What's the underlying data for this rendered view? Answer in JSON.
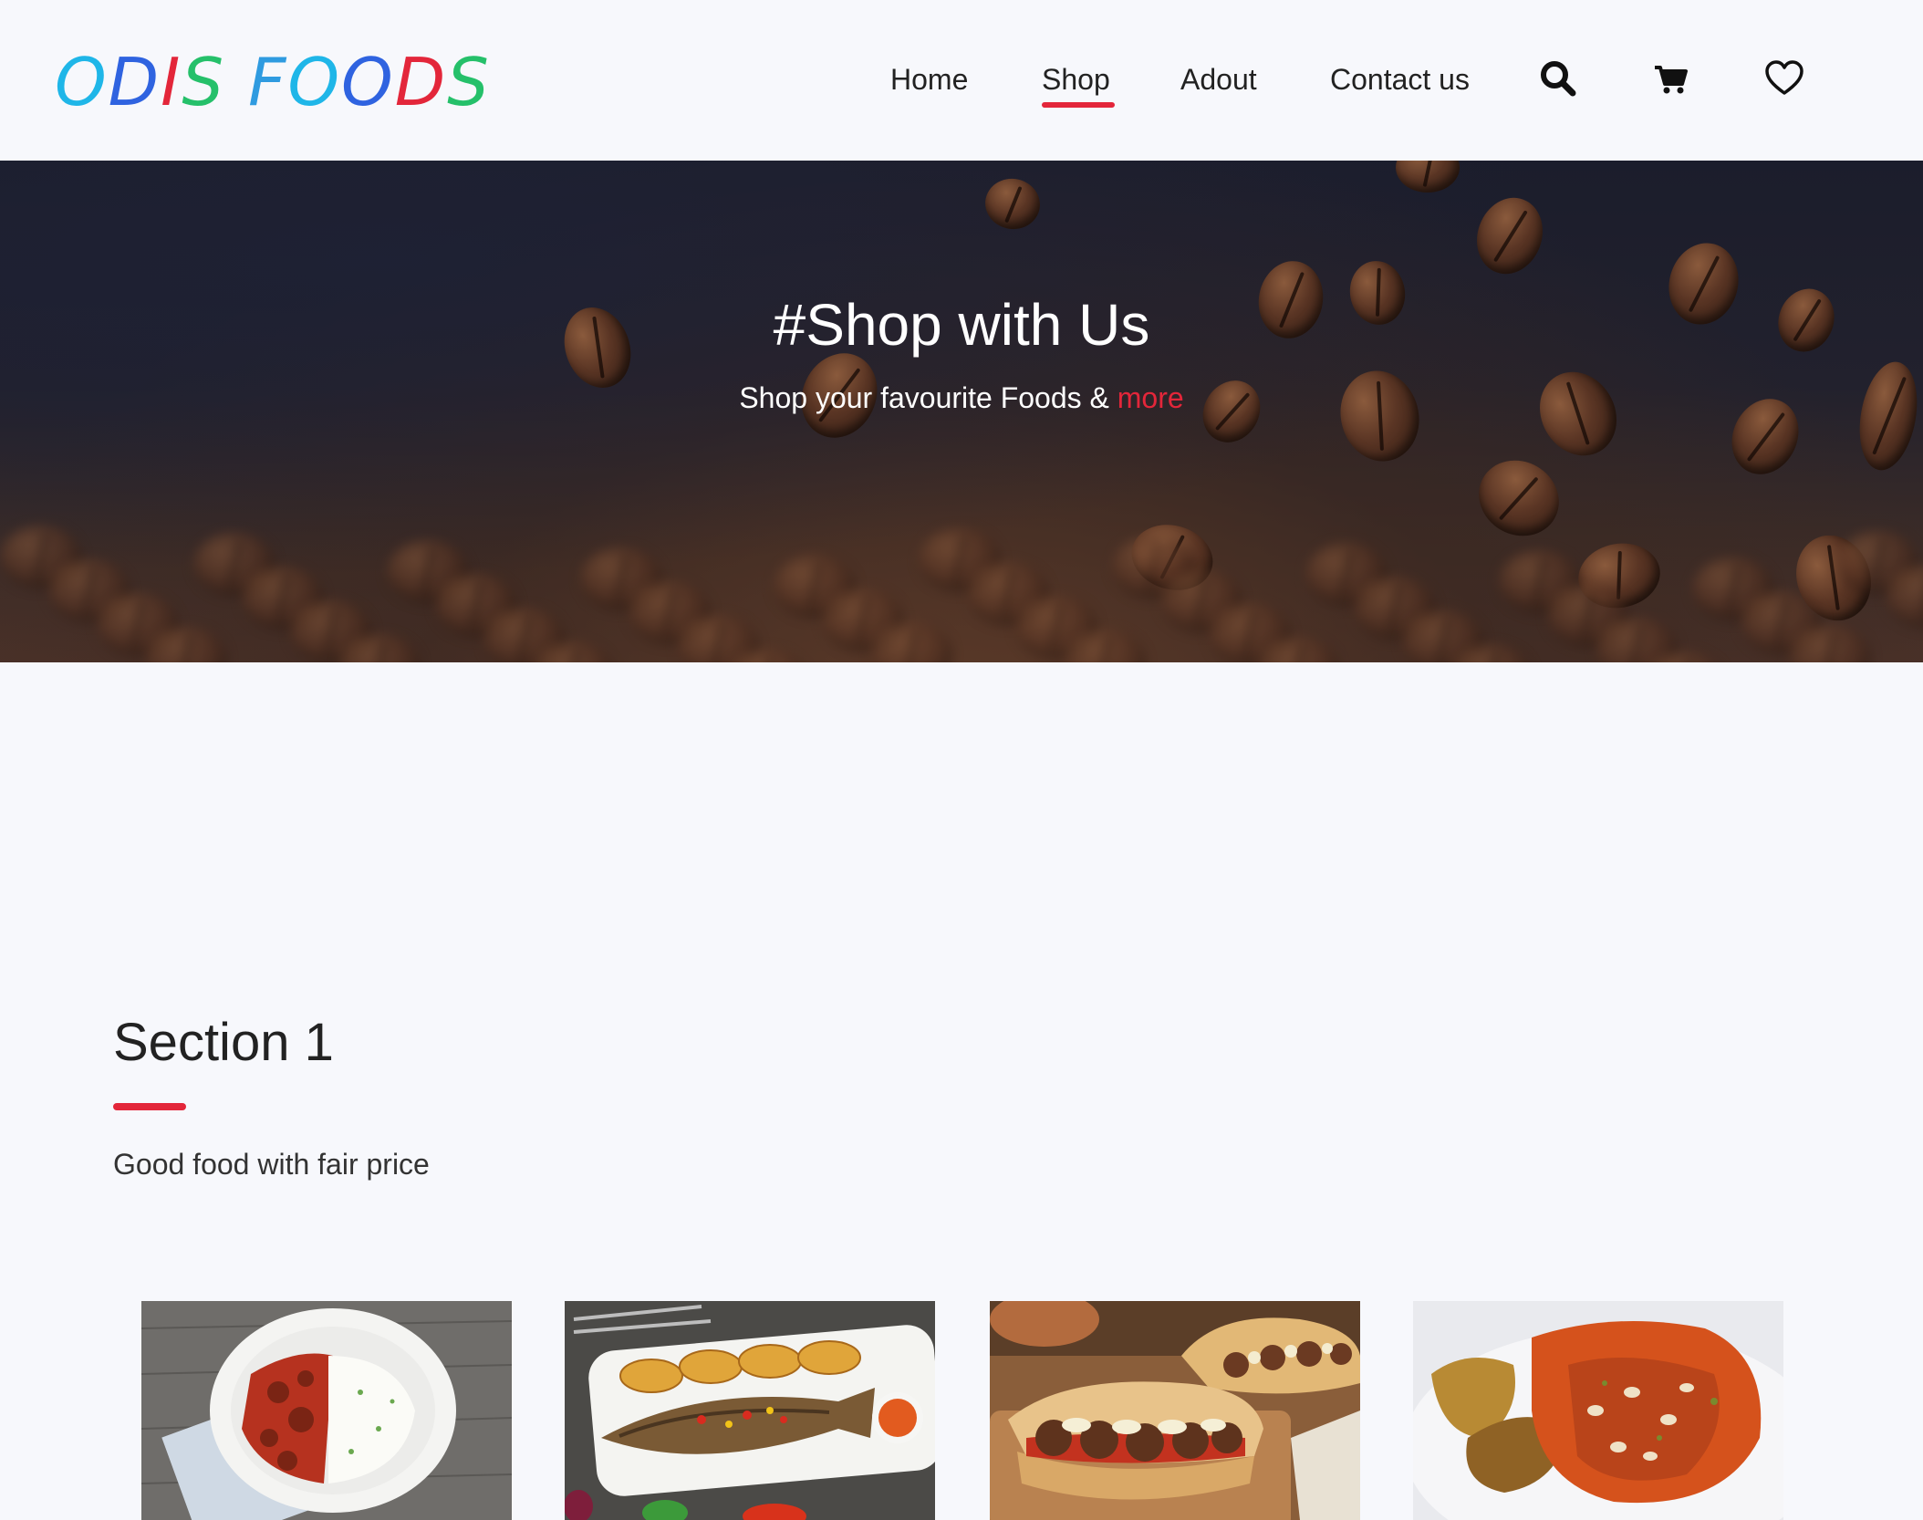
{
  "brand": {
    "logo_letters": [
      {
        "char": "O",
        "color": "#1fb6e8"
      },
      {
        "char": "D",
        "color": "#2f63e0"
      },
      {
        "char": "I",
        "color": "#e3263a"
      },
      {
        "char": "S",
        "color": "#25c06a"
      },
      {
        "char": " ",
        "color": "#000000"
      },
      {
        "char": "F",
        "color": "#2f9be0"
      },
      {
        "char": "O",
        "color": "#1fb6e8"
      },
      {
        "char": "O",
        "color": "#2f63e0"
      },
      {
        "char": "D",
        "color": "#e3263a"
      },
      {
        "char": "S",
        "color": "#25c06a"
      }
    ],
    "accent_color": "#e3263a"
  },
  "nav": {
    "items": [
      {
        "label": "Home",
        "active": false
      },
      {
        "label": "Shop",
        "active": true
      },
      {
        "label": "Adout",
        "active": false
      },
      {
        "label": "Contact us",
        "active": false
      }
    ],
    "icons": [
      "search-icon",
      "cart-icon",
      "heart-icon"
    ]
  },
  "hero": {
    "title": "#Shop with Us",
    "subtitle_prefix": "Shop your favourite Foods & ",
    "subtitle_accent": "more"
  },
  "section": {
    "title": "Section 1",
    "subtitle": "Good food with fair price"
  },
  "products": [
    {
      "image": "stew-and-rice"
    },
    {
      "image": "grilled-fish-with-plantain"
    },
    {
      "image": "meatball-sandwiches"
    },
    {
      "image": "plantain-with-beans-stew"
    }
  ]
}
